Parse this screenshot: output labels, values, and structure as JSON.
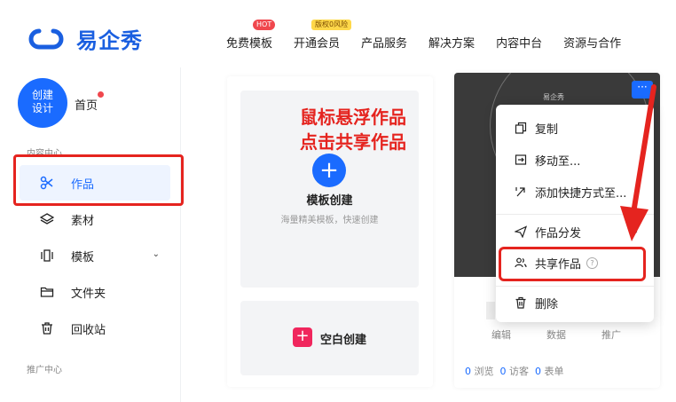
{
  "brand": {
    "name": "易企秀",
    "accent": "#1a6bff",
    "logo_icon": "infinity-logo-icon"
  },
  "nav": {
    "items": [
      {
        "label": "免费模板",
        "badge": "HOT"
      },
      {
        "label": "开通会员",
        "badge": "版权0风险"
      },
      {
        "label": "产品服务"
      },
      {
        "label": "解决方案"
      },
      {
        "label": "内容中台"
      },
      {
        "label": "资源与合作"
      }
    ]
  },
  "sidebar": {
    "create_label_1": "创建",
    "create_label_2": "设计",
    "home": "首页",
    "section_content": "内容中心",
    "section_promo": "推广中心",
    "items": [
      {
        "label": "作品",
        "icon": "scissors-icon",
        "active": true
      },
      {
        "label": "素材",
        "icon": "layers-icon"
      },
      {
        "label": "模板",
        "icon": "template-icon",
        "has_chevron": true
      },
      {
        "label": "文件夹",
        "icon": "folder-icon"
      },
      {
        "label": "回收站",
        "icon": "trash-icon"
      }
    ]
  },
  "main": {
    "template_card": {
      "title": "模板创建",
      "subtitle": "海量精美模板，快速创建"
    },
    "blank_card": {
      "label": "空白创建"
    },
    "annotation_line1": "鼠标悬浮作品",
    "annotation_line2": "点击共享作品"
  },
  "work_card": {
    "more_label": "···",
    "thumb_text": "易企秀",
    "tabs": [
      "编辑",
      "数据",
      "推广"
    ],
    "stats": [
      {
        "num": "0",
        "label": "浏览"
      },
      {
        "num": "0",
        "label": "访客"
      },
      {
        "num": "0",
        "label": "表单"
      }
    ]
  },
  "dropdown": {
    "items": [
      {
        "label": "复制",
        "icon": "copy-icon"
      },
      {
        "label": "移动至...",
        "icon": "move-icon"
      },
      {
        "label": "添加快捷方式至...",
        "icon": "shortcut-icon"
      },
      {
        "label": "作品分发",
        "icon": "send-icon",
        "has_arrow": true
      },
      {
        "label": "共享作品",
        "icon": "users-icon",
        "help": "?"
      },
      {
        "label": "删除",
        "icon": "trash-icon"
      }
    ]
  },
  "colors": {
    "highlight": "#e5241f",
    "primary": "#1a6bff"
  }
}
